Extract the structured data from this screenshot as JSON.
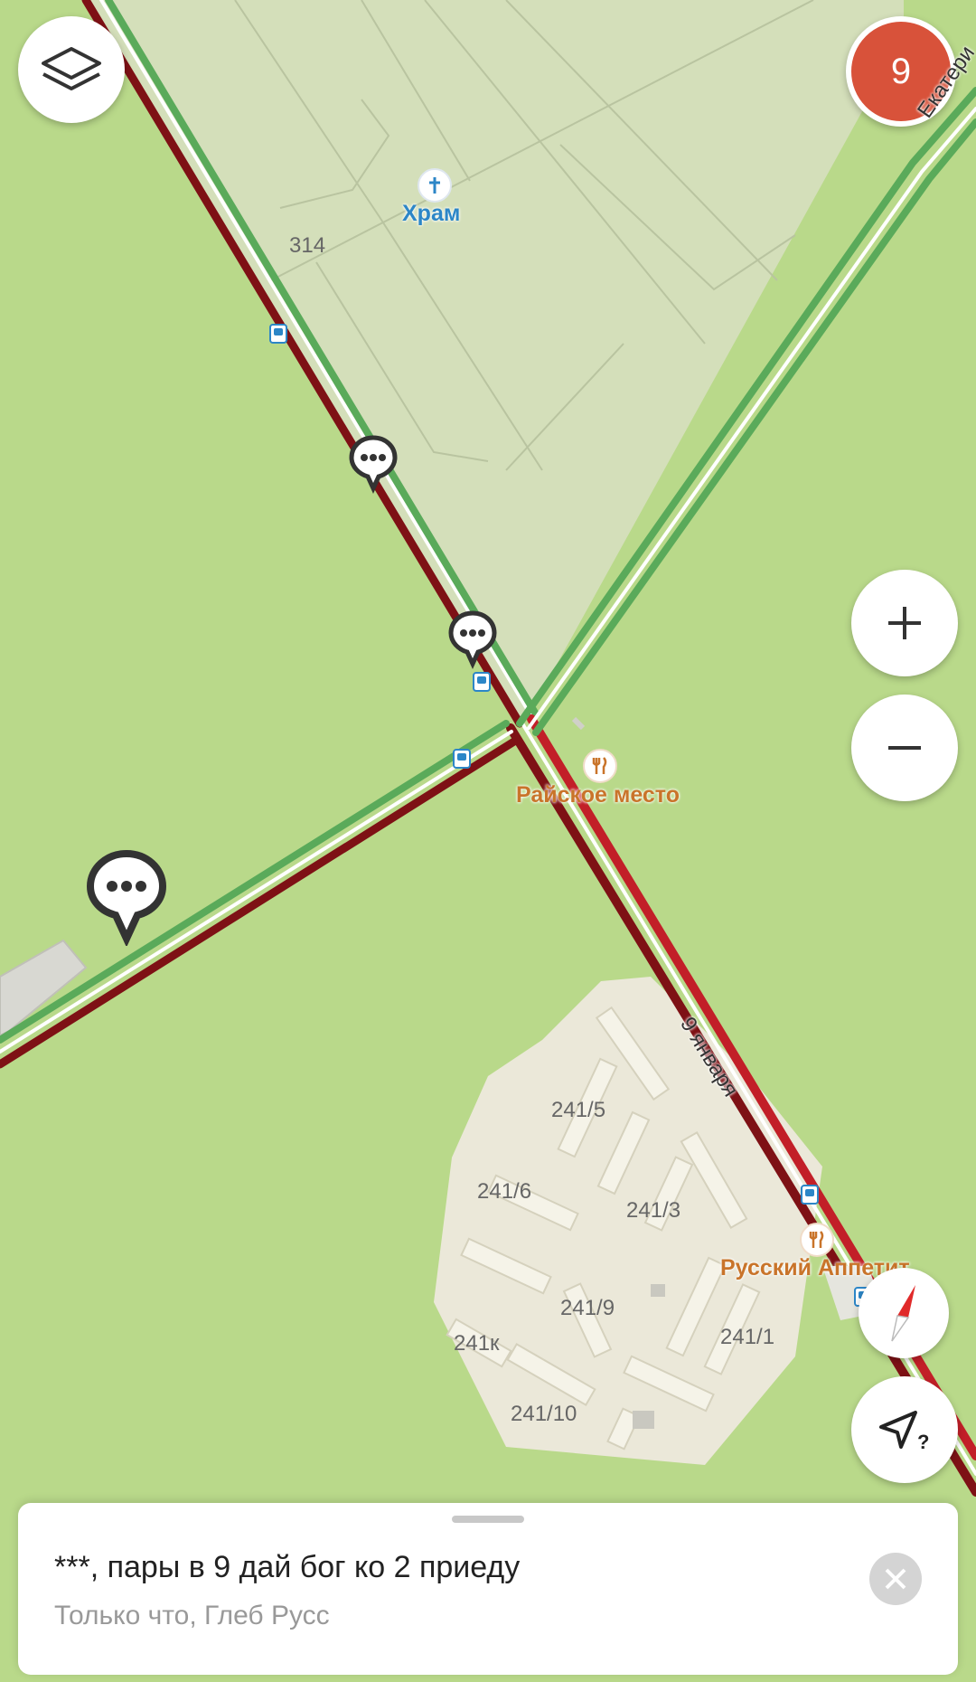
{
  "map": {
    "streets": [
      "9 января",
      "Екатери"
    ],
    "pois": [
      {
        "name": "Храм",
        "icon": "church-icon"
      },
      {
        "name": "Райское место",
        "icon": "restaurant-icon"
      },
      {
        "name": "Русский Аппетит",
        "icon": "restaurant-icon"
      }
    ],
    "house_numbers": [
      "314",
      "241/5",
      "241/6",
      "241/3",
      "241/9",
      "241к",
      "241/1",
      "241/10"
    ],
    "colors": {
      "background": "#b9d98a",
      "park": "#d4dfba",
      "block": "#ebe8d9",
      "road_green": "#5aaa5a",
      "road_red": "#c21f28",
      "road_darkred": "#7e1115"
    }
  },
  "controls": {
    "traffic_level": "9",
    "layers_icon": "layers-icon",
    "zoom_in_icon": "plus-icon",
    "zoom_out_icon": "minus-icon",
    "compass_icon": "compass-icon",
    "locate_icon": "locate-question-icon"
  },
  "message": {
    "text": "***, пары в 9 дай бог ко 2 приеду",
    "meta": "Только что, Глеб Русс",
    "close_icon": "close-icon"
  }
}
